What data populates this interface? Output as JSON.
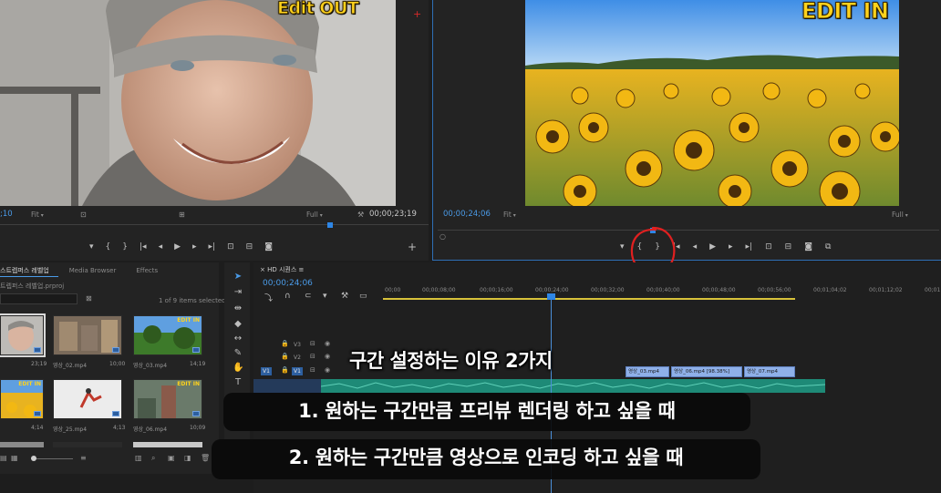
{
  "source_monitor": {
    "overlay_title": "Edit OUT",
    "timecode": ";10",
    "fit": "Fit",
    "resolution": "Full",
    "duration": "00;00;23;19"
  },
  "program_monitor": {
    "overlay_title": "EDIT IN",
    "timecode": "00;00;24;06",
    "fit": "Fit",
    "resolution": "Full"
  },
  "transport": {
    "marker": "▾",
    "in_point": "{",
    "out_point": "}",
    "go_to_in": "|◂",
    "step_back": "◂",
    "play": "▶",
    "step_forward": "▸",
    "go_to_out": "▸|",
    "insert": "⊡",
    "overwrite": "⊟",
    "export_frame": "◙",
    "add": "+"
  },
  "project_panel": {
    "tabs": [
      "스트렙퍼스 레벨업",
      "Media Browser",
      "Effects"
    ],
    "project_file": "트렙퍼스 레벨업.prproj",
    "items_selected": "1 of 9 items selected",
    "items": [
      {
        "name": "",
        "duration": "23;19",
        "overlay": ""
      },
      {
        "name": "영상_02.mp4",
        "duration": "10;00",
        "overlay": ""
      },
      {
        "name": "영상_03.mp4",
        "duration": "14;19",
        "overlay": "EDIT IN"
      },
      {
        "name": "",
        "duration": "4;14",
        "overlay": "EDIT IN"
      },
      {
        "name": "영상_25.mp4",
        "duration": "4;13",
        "overlay": ""
      },
      {
        "name": "영상_06.mp4",
        "duration": "10;09",
        "overlay": "EDIT IN"
      }
    ]
  },
  "timeline": {
    "sequence_tab": "HD 시퀀스",
    "timecode": "00;00;24;06",
    "ruler": [
      "00;00",
      "00;00;08;00",
      "00;00;16;00",
      "00;00;24;00",
      "00;00;32;00",
      "00;00;40;00",
      "00;00;48;00",
      "00;00;56;00",
      "00;01;04;02",
      "00;01;12;02",
      "00;01"
    ],
    "tracks": [
      "V3",
      "V2",
      "V1"
    ],
    "source_patch": "V1",
    "clips": [
      "영상_03.mp4",
      "영상_06.mp4 [98.38%]",
      "영상_07.mp4"
    ]
  },
  "subtitles": {
    "title": "구간 설정하는 이유 2가지",
    "line1": "1. 원하는 구간만큼 프리뷰 렌더링 하고 싶을 때",
    "line2": "2. 원하는 구간만큼 영상으로 인코딩 하고 싶을 때"
  },
  "colors": {
    "accent_blue": "#2e86e6",
    "timecode_blue": "#4a9be8",
    "overlay_yellow": "#ffd21c",
    "annotation_red": "#e02020",
    "audio_green": "#1e8a77",
    "clip_blue": "#8fb0e8"
  }
}
